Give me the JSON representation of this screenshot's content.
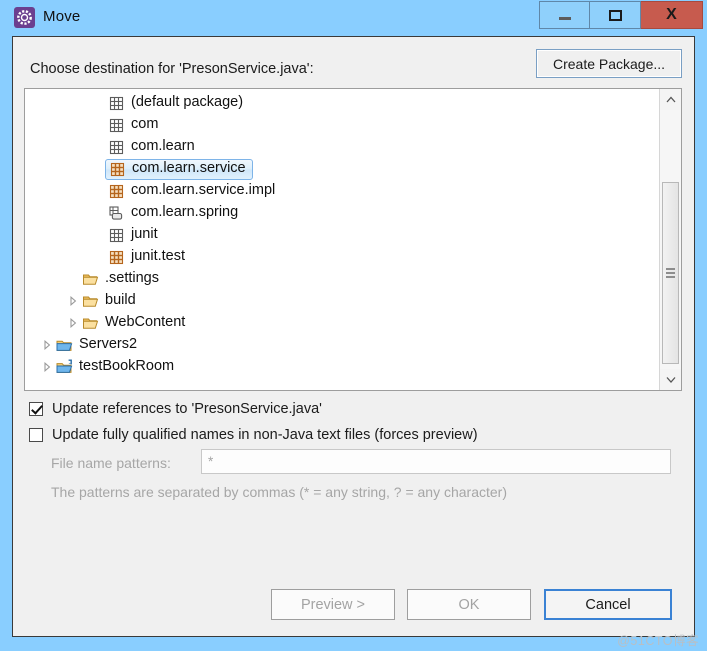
{
  "window": {
    "title": "Move",
    "icon": "move-dialog-icon",
    "controls": {
      "minimize": "minimize-icon",
      "maximize": "maximize-icon",
      "close": "X"
    }
  },
  "header": {
    "prompt": "Choose destination for 'PresonService.java':",
    "create_package_label": "Create Package..."
  },
  "tree": {
    "items": [
      {
        "label": "(default package)",
        "icon": "package-empty-icon",
        "indent": 3,
        "arrow": "none",
        "selected": false
      },
      {
        "label": "com",
        "icon": "package-empty-icon",
        "indent": 3,
        "arrow": "none",
        "selected": false
      },
      {
        "label": "com.learn",
        "icon": "package-empty-icon",
        "indent": 3,
        "arrow": "none",
        "selected": false
      },
      {
        "label": "com.learn.service",
        "icon": "package-full-icon",
        "indent": 3,
        "arrow": "none",
        "selected": true
      },
      {
        "label": "com.learn.service.impl",
        "icon": "package-full-icon",
        "indent": 3,
        "arrow": "none",
        "selected": false
      },
      {
        "label": "com.learn.spring",
        "icon": "package-source-icon",
        "indent": 3,
        "arrow": "none",
        "selected": false
      },
      {
        "label": "junit",
        "icon": "package-empty-icon",
        "indent": 3,
        "arrow": "none",
        "selected": false
      },
      {
        "label": "junit.test",
        "icon": "package-full-icon",
        "indent": 3,
        "arrow": "none",
        "selected": false
      },
      {
        "label": ".settings",
        "icon": "folder-icon",
        "indent": 2,
        "arrow": "none",
        "selected": false
      },
      {
        "label": "build",
        "icon": "folder-icon",
        "indent": 2,
        "arrow": "collapsed",
        "selected": false
      },
      {
        "label": "WebContent",
        "icon": "folder-icon",
        "indent": 2,
        "arrow": "collapsed",
        "selected": false
      },
      {
        "label": "Servers2",
        "icon": "project-icon",
        "indent": 1,
        "arrow": "collapsed",
        "selected": false
      },
      {
        "label": "testBookRoom",
        "icon": "java-project-icon",
        "indent": 1,
        "arrow": "collapsed",
        "selected": false
      }
    ],
    "scrollbar": {
      "up": "scroll-up-icon",
      "down": "scroll-down-icon"
    }
  },
  "options": {
    "update_references": {
      "label": "Update references to 'PresonService.java'",
      "checked": true
    },
    "update_qualified": {
      "label": "Update fully qualified names in non-Java text files (forces preview)",
      "checked": false
    }
  },
  "patterns": {
    "label": "File name patterns:",
    "value": "*",
    "hint": "The patterns are separated by commas (* = any string, ? = any character)"
  },
  "buttons": {
    "preview": "Preview >",
    "ok": "OK",
    "cancel": "Cancel"
  },
  "watermark": "@51CTO博客",
  "colors": {
    "titlebar": "#89ceff",
    "dialog_bg": "#f0f0f0",
    "close_button": "#c75b4e",
    "selection_border": "#7eb4e8",
    "focus_border": "#3a82d4"
  }
}
